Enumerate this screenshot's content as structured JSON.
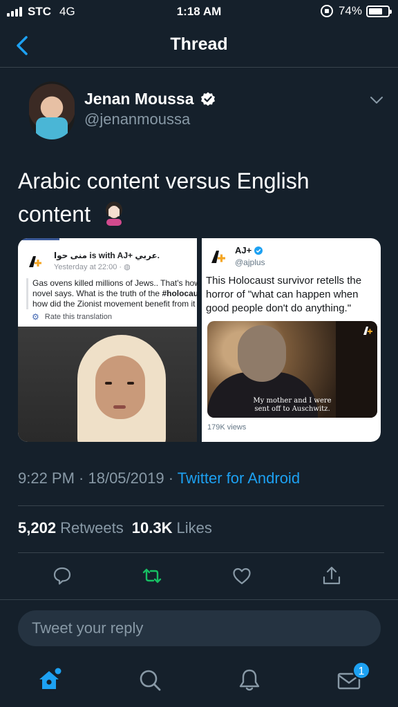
{
  "status_bar": {
    "carrier": "STC",
    "network": "4G",
    "time": "1:18 AM",
    "battery": "74%",
    "battery_level": 0.74
  },
  "nav": {
    "title": "Thread",
    "back_icon": "chevron-left-icon"
  },
  "tweet": {
    "author_name": "Jenan Moussa",
    "author_handle": "@jenanmoussa",
    "text": "Arabic content versus English content",
    "emoji": "facepalm-emoji",
    "timestamp": "9:22 PM · 18/05/2019 · ",
    "source": "Twitter for Android",
    "retweets_count": "5,202",
    "retweets_label": "Retweets",
    "likes_count": "10.3K",
    "likes_label": "Likes"
  },
  "media": {
    "left_card": {
      "header": "منى حوا is with AJ+ عربي.",
      "meta": "Yesterday at 22:00 · ",
      "body_line1": "Gas ovens killed millions of Jews.. That's how",
      "body_line2_a": "novel says. What is the truth of the ",
      "body_line2_b": "#holocau",
      "body_line3": "how did the Zionist movement benefit from it",
      "rate": "Rate this translation"
    },
    "right_card": {
      "name": "AJ+",
      "handle": "@ajplus",
      "text": "This Holocaust survivor retells the horror of \"what can happen when good people don't do anything.\"",
      "caption_line1": "My mother and I were",
      "caption_line2": "sent off to Auschwitz.",
      "views": "179K views"
    }
  },
  "reply": {
    "placeholder": "Tweet your reply"
  },
  "tabbar": {
    "items": [
      "home-icon",
      "search-icon",
      "bell-icon",
      "mail-icon"
    ],
    "messages_badge": "1"
  },
  "colors": {
    "background": "#15202b",
    "accent": "#1da1f2",
    "retweet_green": "#17bf63",
    "muted": "#8899a6"
  }
}
